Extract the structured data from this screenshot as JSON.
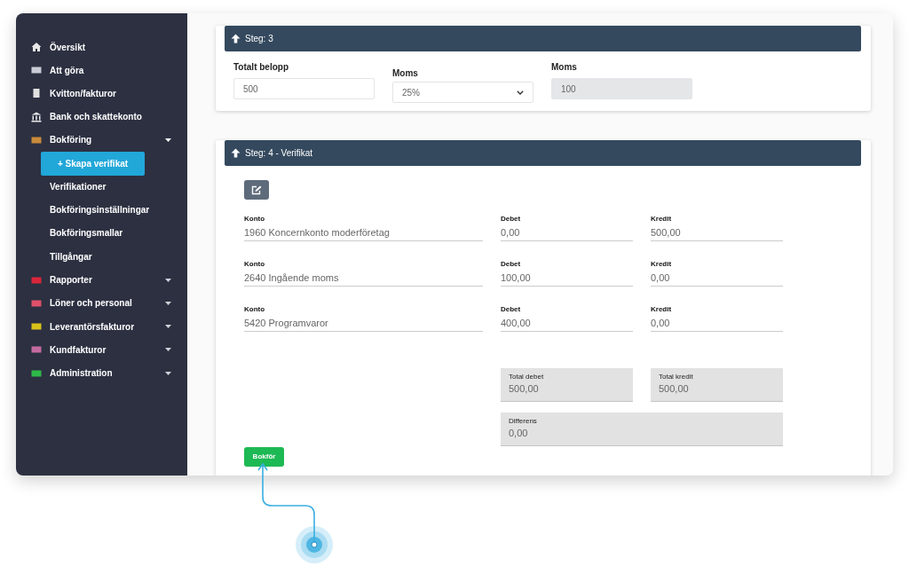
{
  "sidebar": {
    "items": [
      {
        "label": "Översikt",
        "color": "#e8e8e8"
      },
      {
        "label": "Att göra",
        "color": "#c9ccd6"
      },
      {
        "label": "Kvitton/fakturor",
        "color": "#e0e0e0"
      },
      {
        "label": "Bank och skattekonto",
        "color": "#e8e8e8"
      },
      {
        "label": "Bokföring",
        "color": "#c98a3c",
        "expanded": true,
        "children": [
          {
            "label": "+ Skapa verifikat",
            "selected": true
          },
          {
            "label": "Verifikationer",
            "selected": false
          },
          {
            "label": "Bokföringsinställningar",
            "selected": false
          },
          {
            "label": "Bokföringsmallar",
            "selected": false
          },
          {
            "label": "Tillgångar",
            "selected": false
          }
        ]
      },
      {
        "label": "Rapporter",
        "color": "#d9263a",
        "expanded": false
      },
      {
        "label": "Löner och personal",
        "color": "#e0506a",
        "expanded": false
      },
      {
        "label": "Leverantörsfakturor",
        "color": "#d8c21a",
        "expanded": false
      },
      {
        "label": "Kundfakturor",
        "color": "#c46aa0",
        "expanded": false
      },
      {
        "label": "Administration",
        "color": "#2fb84a",
        "expanded": false
      }
    ]
  },
  "step3": {
    "title": "Steg: 3",
    "fields": [
      {
        "label": "Totalt belopp",
        "kind": "input",
        "value": "500"
      },
      {
        "label": "Moms",
        "kind": "select",
        "value": "25%"
      },
      {
        "label": "Moms",
        "kind": "readonly",
        "value": "100"
      }
    ]
  },
  "step4": {
    "title": "Steg: 4 - Verifikat",
    "rows": [
      {
        "konto_label": "Konto",
        "konto": "1960 Koncernkonto moderföretag",
        "debet_label": "Debet",
        "debet": "0,00",
        "kredit_label": "Kredit",
        "kredit": "500,00"
      },
      {
        "konto_label": "Konto",
        "konto": "2640 Ingående moms",
        "debet_label": "Debet",
        "debet": "100,00",
        "kredit_label": "Kredit",
        "kredit": "0,00"
      },
      {
        "konto_label": "Konto",
        "konto": "5420 Programvaror",
        "debet_label": "Debet",
        "debet": "400,00",
        "kredit_label": "Kredit",
        "kredit": "0,00"
      }
    ],
    "totals": [
      {
        "label": "Total debet",
        "value": "500,00"
      },
      {
        "label": "Total kredit",
        "value": "500,00"
      }
    ],
    "difference": {
      "label": "Differens",
      "value": "0,00"
    },
    "submit": "Bokför"
  }
}
